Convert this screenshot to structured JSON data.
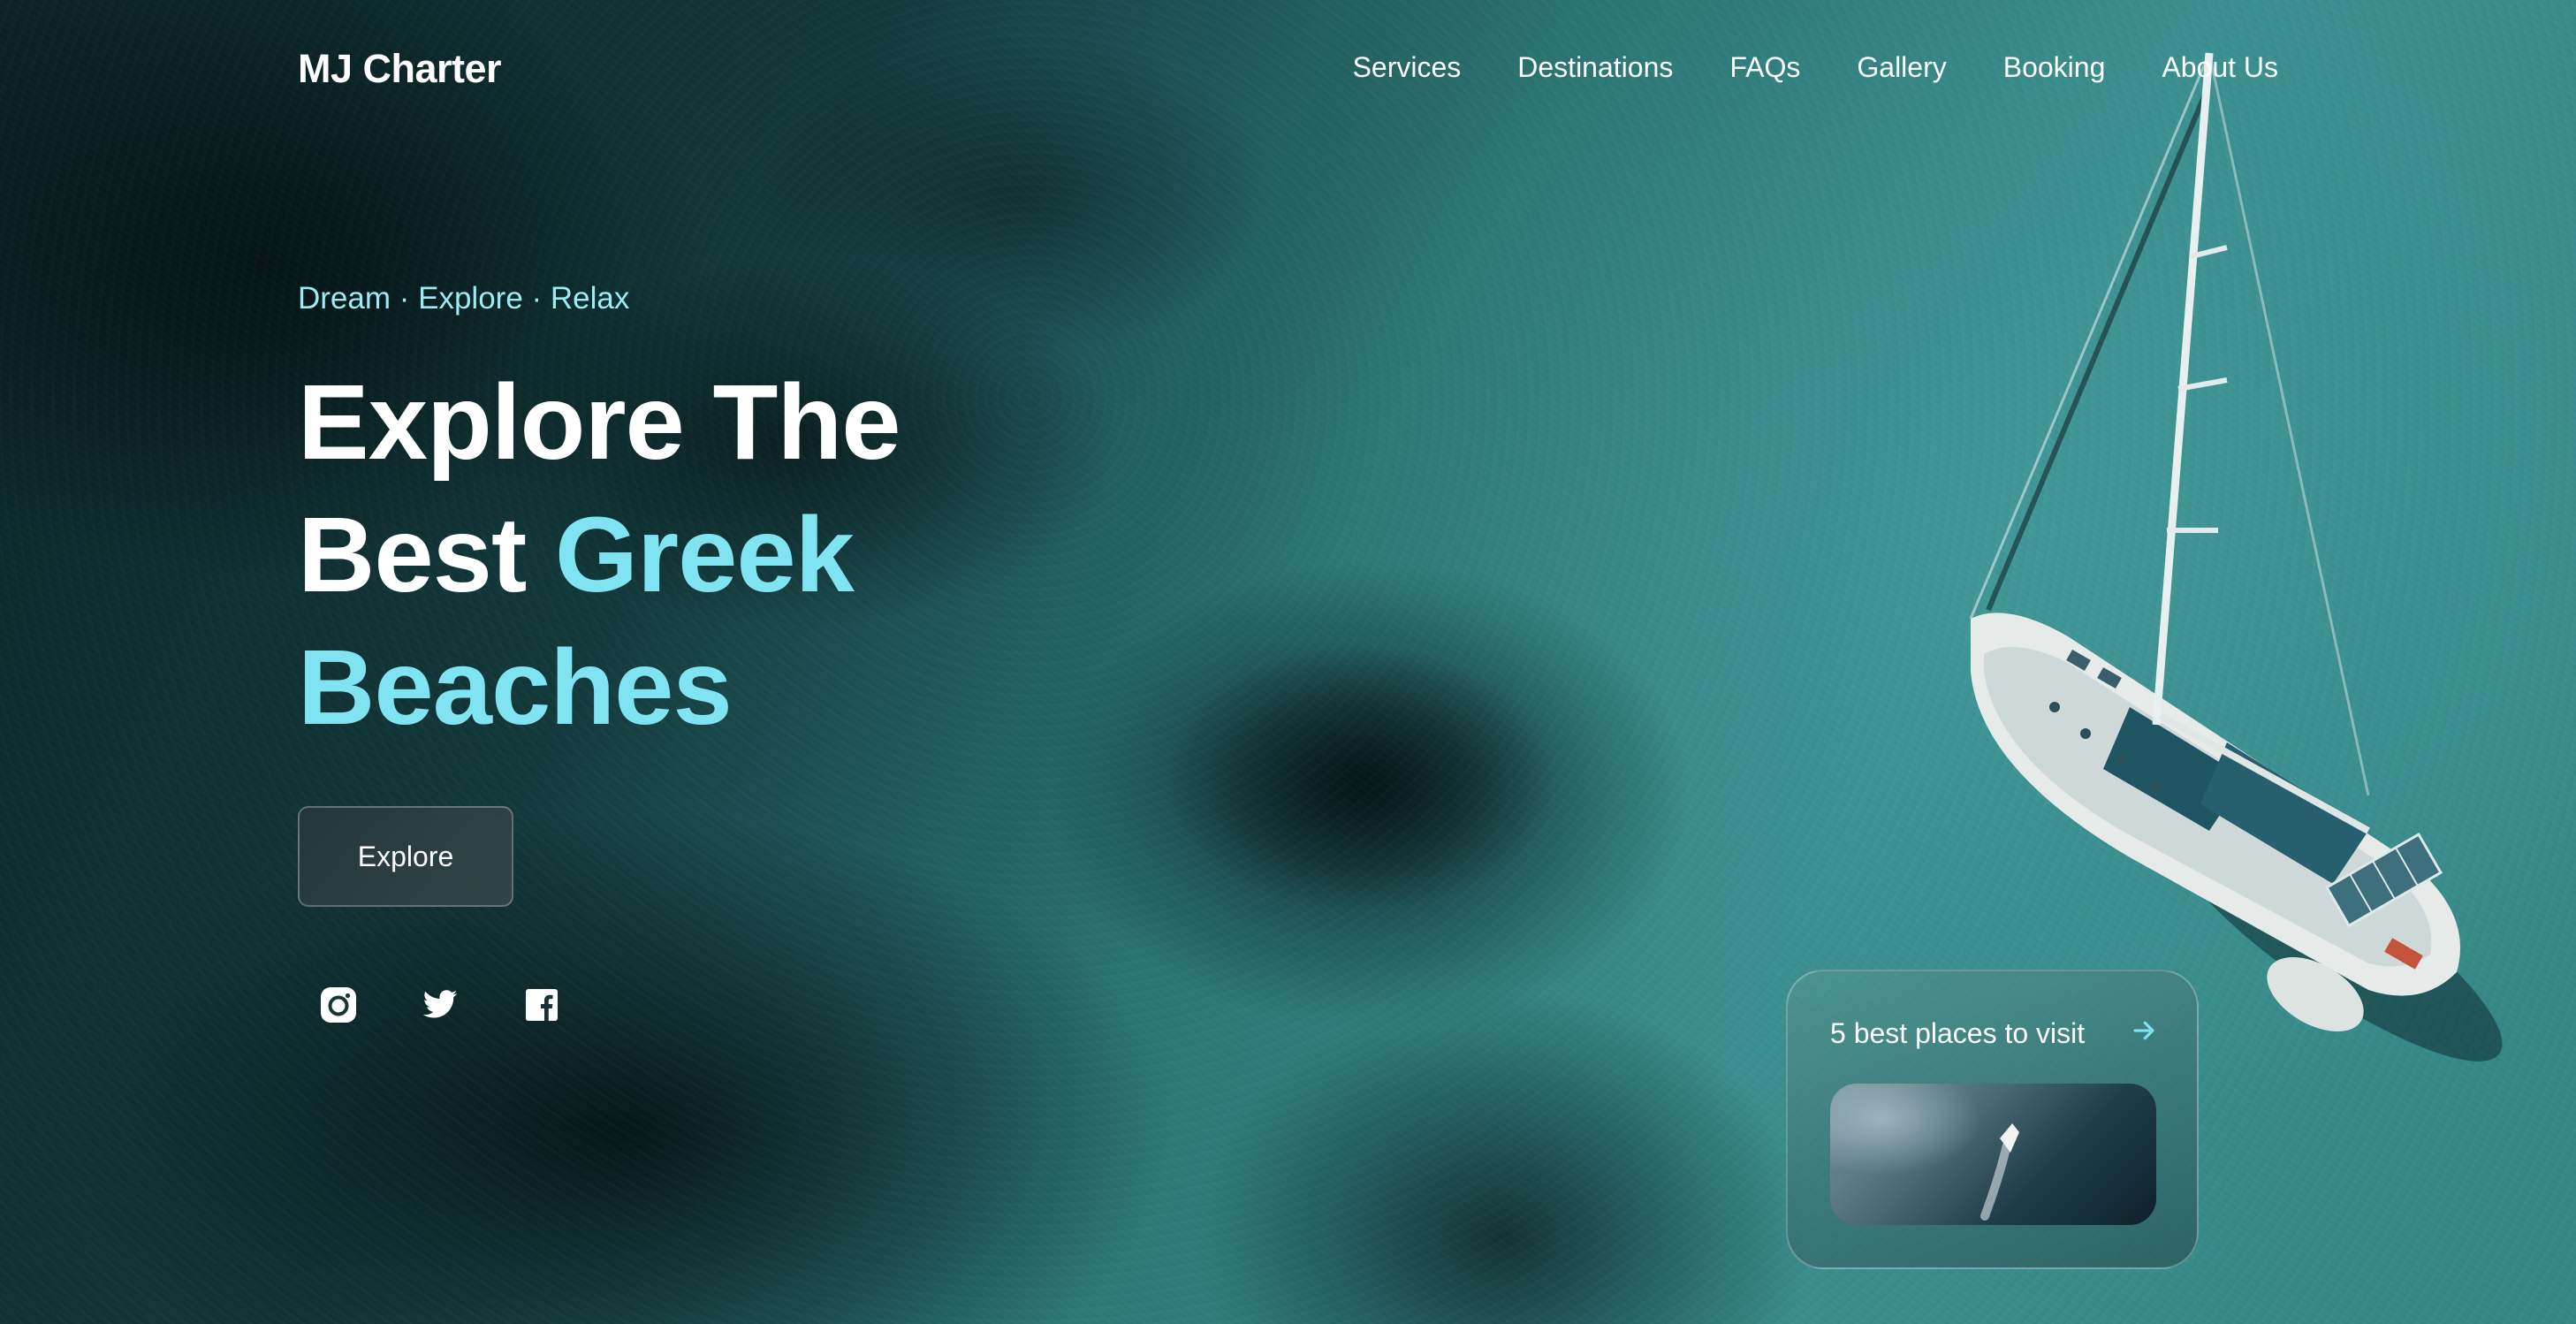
{
  "header": {
    "brand": "MJ Charter",
    "nav": [
      "Services",
      "Destinations",
      "FAQs",
      "Gallery",
      "Booking",
      "About Us"
    ]
  },
  "hero": {
    "tagline": "Dream · Explore · Relax",
    "headline": {
      "line1": "Explore The",
      "line2_plain": "Best ",
      "line2_accent": "Greek",
      "line3_accent": "Beaches"
    },
    "explore_label": "Explore"
  },
  "socials": [
    {
      "icon": "instagram-icon"
    },
    {
      "icon": "twitter-icon"
    },
    {
      "icon": "facebook-icon"
    }
  ],
  "card": {
    "title": "5 best places to visit",
    "arrow_icon": "arrow-right-icon"
  },
  "colors": {
    "accent": "#7fe3f2",
    "tagline": "#9ceaf2",
    "text": "#ffffff"
  }
}
